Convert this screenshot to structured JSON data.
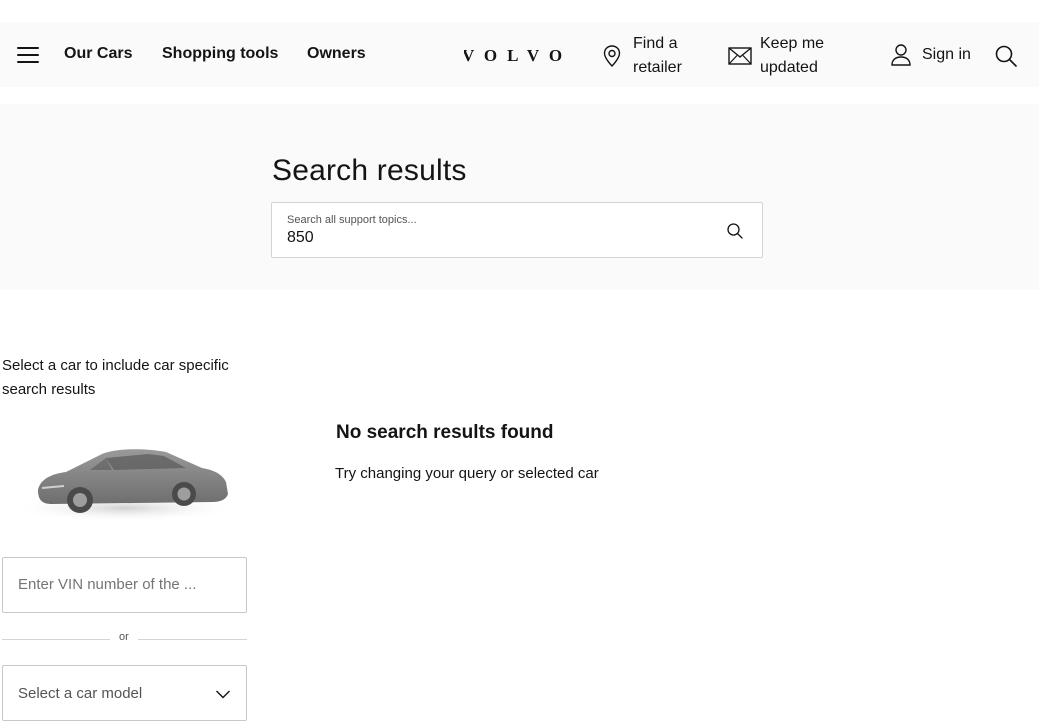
{
  "header": {
    "nav": {
      "our_cars": "Our Cars",
      "shopping_tools": "Shopping tools",
      "owners": "Owners"
    },
    "logo_text": "VOLVO",
    "find_retailer": "Find a retailer",
    "keep_updated": "Keep me updated",
    "sign_in": "Sign in"
  },
  "hero": {
    "title": "Search results",
    "search": {
      "label": "Search all support topics...",
      "value": "850"
    }
  },
  "car_selector": {
    "hint": "Select a car to include car specific search results",
    "vin_placeholder": "Enter VIN number of the ...",
    "or_text": "or",
    "model_placeholder": "Select a car model"
  },
  "results": {
    "heading": "No search results found",
    "subtext": "Try changing your query or selected car"
  },
  "colors": {
    "text": "#141414",
    "muted": "#545454",
    "band": "#fafafa",
    "border": "#c8c8c8"
  },
  "icons": [
    "menu-icon",
    "location-pin-icon",
    "envelope-icon",
    "user-icon",
    "search-icon",
    "chevron-down-icon"
  ]
}
